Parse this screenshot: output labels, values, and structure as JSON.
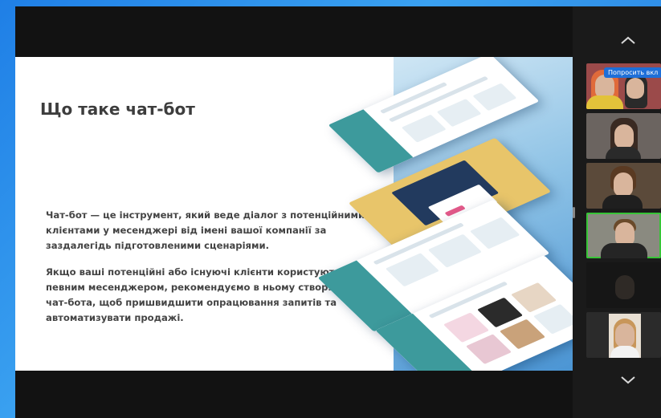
{
  "slide": {
    "title": "Що таке чат-бот",
    "paragraph_1": "Чат-бот — це інструмент, який веде діалог з потенційними клієнтами у месенджері від імені вашої компанії за заздалегідь підготовленими сценаріями.",
    "paragraph_2": "Якщо ваші потенційні або існуючі клієнти користуються певним месенджером, рекомендуємо в ньому створити чат-бота, щоб пришвидшити опрацювання запитів та автоматизувати продажі."
  },
  "participants": {
    "request_label": "Попросить вкл",
    "count_visible": 6
  },
  "icons": {
    "scroll_up": "chevron-up-icon",
    "scroll_down": "chevron-down-icon"
  },
  "colors": {
    "accent": "#1e6fd8",
    "active_speaker": "#37c437",
    "slide_text": "#3d3d3d"
  }
}
